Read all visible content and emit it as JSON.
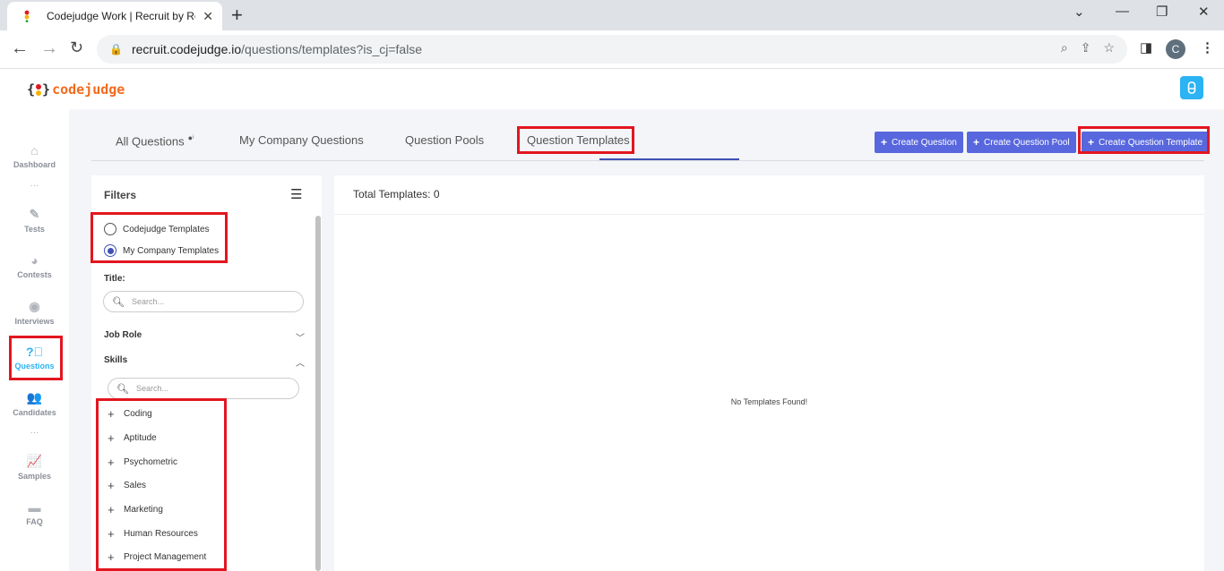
{
  "browser": {
    "tab_title": "Codejudge Work | Recruit by Rea",
    "url_host": "recruit.codejudge.io",
    "url_path": "/questions/templates?is_cj=false",
    "profile_initial": "C"
  },
  "app": {
    "logo_left": "{",
    "logo_right": "}",
    "logo_text": "codejudge",
    "brand_color": "#f26b1d",
    "accent_color": "#2bb3f3",
    "button_color": "#5867dd"
  },
  "sidebar": {
    "items": [
      {
        "label": "Dashboard",
        "icon": "home-icon"
      },
      {
        "label": "Tests",
        "icon": "pencil-icon"
      },
      {
        "label": "Contests",
        "icon": "pie-chart-icon"
      },
      {
        "label": "Interviews",
        "icon": "podcast-icon"
      },
      {
        "label": "Questions",
        "icon": "question-circle-icon"
      },
      {
        "label": "Candidates",
        "icon": "users-icon"
      },
      {
        "label": "Samples",
        "icon": "line-chart-icon"
      },
      {
        "label": "FAQ",
        "icon": "chat-icon"
      }
    ],
    "active": "Questions"
  },
  "tabs": {
    "all_questions": "All Questions",
    "my_company": "My Company Questions",
    "pools": "Question Pools",
    "templates": "Question Templates",
    "active": "Question Templates"
  },
  "actions": {
    "create_question": "Create Question",
    "create_pool": "Create Question Pool",
    "create_template": "Create Question Template"
  },
  "filters": {
    "title": "Filters",
    "source_options": [
      "Codejudge Templates",
      "My Company Templates"
    ],
    "source_selected": "My Company Templates",
    "title_label": "Title:",
    "title_placeholder": "Search...",
    "job_role_label": "Job Role",
    "skills_label": "Skills",
    "skills_placeholder": "Search...",
    "skills": [
      "Coding",
      "Aptitude",
      "Psychometric",
      "Sales",
      "Marketing",
      "Human Resources",
      "Project Management"
    ]
  },
  "main": {
    "total_label": "Total Templates: 0",
    "empty_message": "No Templates Found!"
  }
}
